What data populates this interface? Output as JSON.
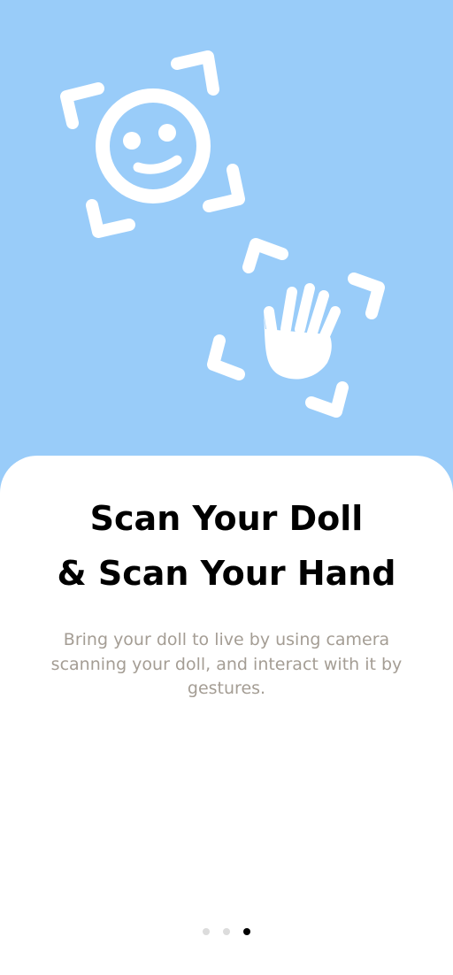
{
  "onboarding": {
    "title_line1": "Scan Your Doll",
    "title_line2": "& Scan Your Hand",
    "description": "Bring your doll to live by using camera scanning your doll, and interact with it by gestures.",
    "illustration_icons": [
      "face-scan-icon",
      "hand-scan-icon"
    ],
    "pager": {
      "total_pages": 3,
      "current_page": 3
    }
  },
  "colors": {
    "background": "#99ccf9",
    "card": "#ffffff",
    "title": "#000000",
    "description": "#a49d94",
    "dot_inactive": "#dcdcdc",
    "dot_active": "#000000"
  }
}
